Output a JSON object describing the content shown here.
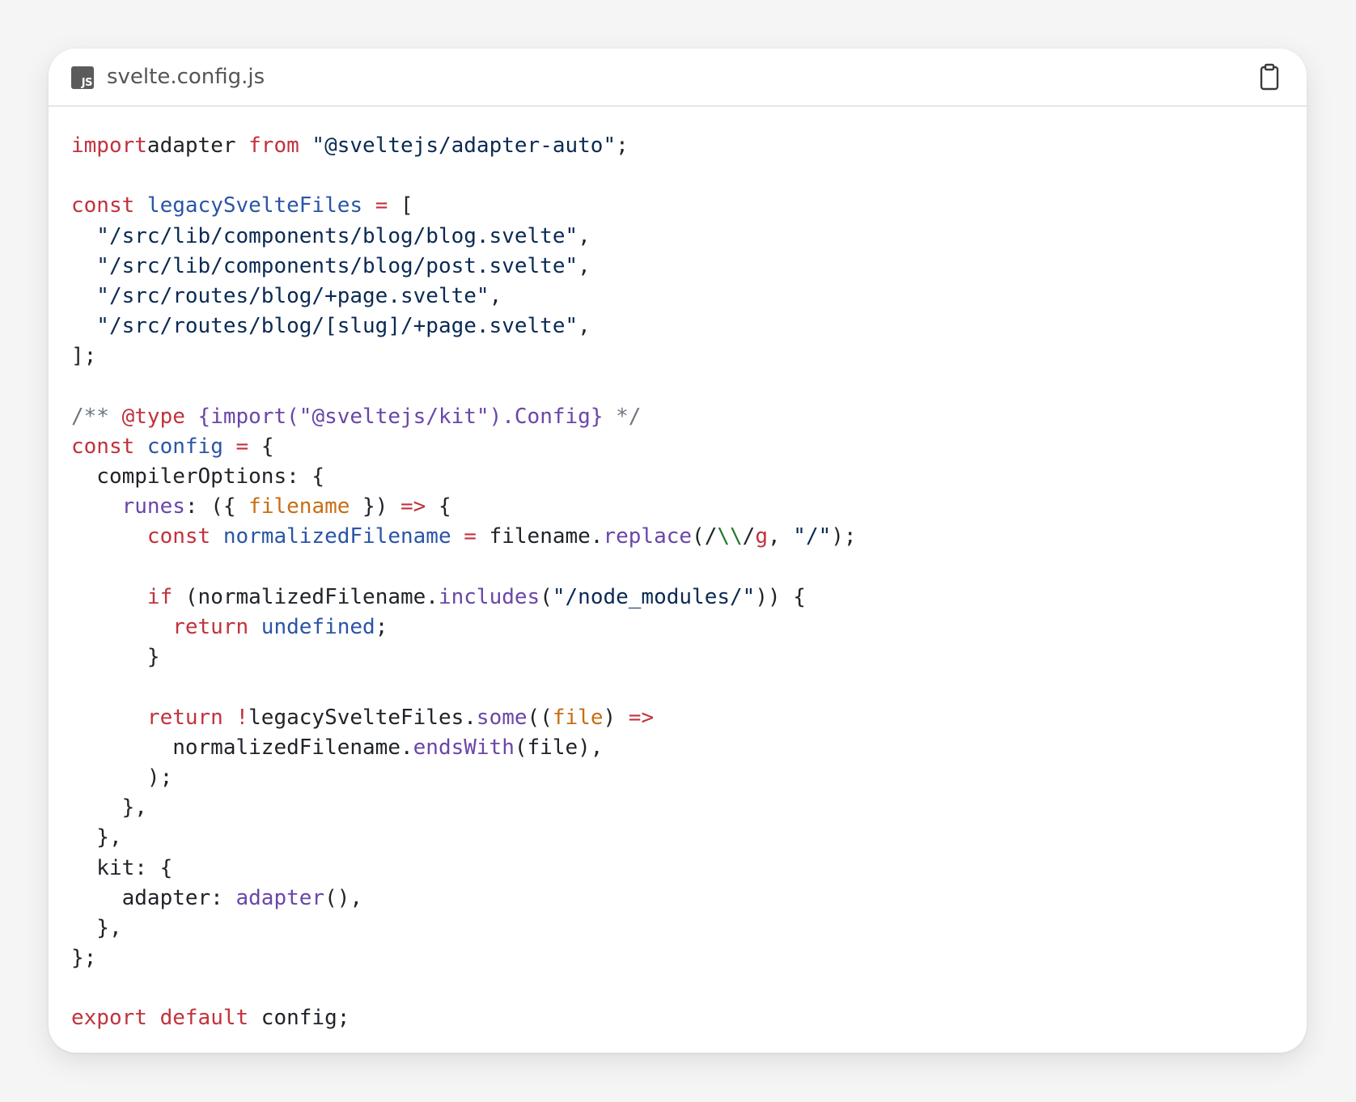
{
  "header": {
    "file_badge": "JS",
    "filename": "svelte.config.js",
    "copy_icon": "clipboard-icon"
  },
  "code_lines": [
    [
      [
        "kw",
        "import"
      ],
      [
        "",
        "adapter"
      ],
      [
        "kw",
        " from"
      ],
      [
        "str",
        " \"@sveltejs/adapter-auto\""
      ],
      [
        "",
        ";"
      ]
    ],
    [],
    [
      [
        "kw",
        "const"
      ],
      [
        "fn",
        " legacySvelteFiles"
      ],
      [
        "kw",
        " ="
      ],
      [
        "",
        " ["
      ]
    ],
    [
      [
        "str",
        "  \"/src/lib/components/blog/blog.svelte\""
      ],
      [
        "",
        ","
      ]
    ],
    [
      [
        "str",
        "  \"/src/lib/components/blog/post.svelte\""
      ],
      [
        "",
        ","
      ]
    ],
    [
      [
        "str",
        "  \"/src/routes/blog/+page.svelte\""
      ],
      [
        "",
        ","
      ]
    ],
    [
      [
        "str",
        "  \"/src/routes/blog/[slug]/+page.svelte\""
      ],
      [
        "",
        ","
      ]
    ],
    [
      [
        "",
        "];"
      ]
    ],
    [],
    [
      [
        "cm",
        "/** "
      ],
      [
        "kw",
        "@type"
      ],
      [
        "cmt",
        " {import(\"@sveltejs/kit\").Config}"
      ],
      [
        "cm",
        " */"
      ]
    ],
    [
      [
        "kw",
        "const"
      ],
      [
        "fn",
        " config"
      ],
      [
        "kw",
        " ="
      ],
      [
        "",
        " {"
      ]
    ],
    [
      [
        "",
        "  compilerOptions: {"
      ]
    ],
    [
      [
        "mth",
        "    runes"
      ],
      [
        "",
        ": ({ "
      ],
      [
        "prm",
        "filename"
      ],
      [
        "",
        " }) "
      ],
      [
        "kw",
        "=>"
      ],
      [
        "",
        " {"
      ]
    ],
    [
      [
        "kw",
        "      const"
      ],
      [
        "fn",
        " normalizedFilename"
      ],
      [
        "kw",
        " ="
      ],
      [
        "",
        " filename."
      ],
      [
        "mth",
        "replace"
      ],
      [
        "",
        "(/"
      ],
      [
        "rx",
        "\\\\"
      ],
      [
        "",
        "/"
      ],
      [
        "kw",
        "g"
      ],
      [
        "",
        ", "
      ],
      [
        "str",
        "\"/\""
      ],
      [
        "",
        ");"
      ]
    ],
    [],
    [
      [
        "kw",
        "      if"
      ],
      [
        "",
        " (normalizedFilename."
      ],
      [
        "mth",
        "includes"
      ],
      [
        "",
        "("
      ],
      [
        "str",
        "\"/node_modules/\""
      ],
      [
        "",
        ")) {"
      ]
    ],
    [
      [
        "kw",
        "        return"
      ],
      [
        "fn",
        " undefined"
      ],
      [
        "",
        ";"
      ]
    ],
    [
      [
        "",
        "      }"
      ]
    ],
    [],
    [
      [
        "kw",
        "      return"
      ],
      [
        "kw",
        " !"
      ],
      [
        "",
        "legacySvelteFiles."
      ],
      [
        "mth",
        "some"
      ],
      [
        "",
        "(("
      ],
      [
        "prm",
        "file"
      ],
      [
        "",
        ") "
      ],
      [
        "kw",
        "=>"
      ]
    ],
    [
      [
        "",
        "        normalizedFilename."
      ],
      [
        "mth",
        "endsWith"
      ],
      [
        "",
        "(file),"
      ]
    ],
    [
      [
        "",
        "      );"
      ]
    ],
    [
      [
        "",
        "    },"
      ]
    ],
    [
      [
        "",
        "  },"
      ]
    ],
    [
      [
        "",
        "  kit: {"
      ]
    ],
    [
      [
        "",
        "    adapter: "
      ],
      [
        "mth",
        "adapter"
      ],
      [
        "",
        "(),"
      ]
    ],
    [
      [
        "",
        "  },"
      ]
    ],
    [
      [
        "",
        "};"
      ]
    ],
    [],
    [
      [
        "kw",
        "export"
      ],
      [
        "kw",
        " default"
      ],
      [
        "",
        " config;"
      ]
    ]
  ]
}
